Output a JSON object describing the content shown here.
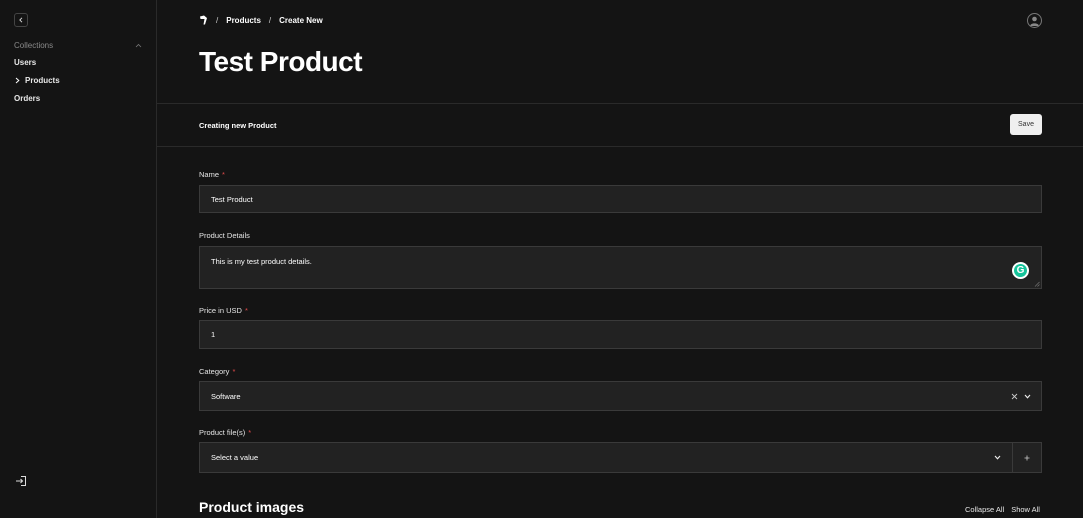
{
  "sidebar": {
    "collections_label": "Collections",
    "items": [
      {
        "label": "Users",
        "active": false
      },
      {
        "label": "Products",
        "active": true
      },
      {
        "label": "Orders",
        "active": false
      }
    ]
  },
  "breadcrumb": {
    "items": [
      "Products",
      "Create New"
    ],
    "separator": "/"
  },
  "page": {
    "title": "Test Product",
    "status_text": "Creating new Product",
    "save_label": "Save"
  },
  "form": {
    "name": {
      "label": "Name",
      "required": "*",
      "value": "Test Product"
    },
    "details": {
      "label": "Product Details",
      "value": "This is my test product details."
    },
    "price": {
      "label": "Price in USD",
      "required": "*",
      "value": "1"
    },
    "category": {
      "label": "Category",
      "required": "*",
      "value": "Software"
    },
    "files": {
      "label": "Product file(s)",
      "required": "*",
      "placeholder": "Select a value"
    }
  },
  "images_section": {
    "title": "Product images",
    "collapse_all": "Collapse All",
    "show_all": "Show All"
  },
  "colors": {
    "background": "#141414",
    "input_bg": "#222222",
    "required": "#e24b4b",
    "grammarly": "#15c39a"
  }
}
